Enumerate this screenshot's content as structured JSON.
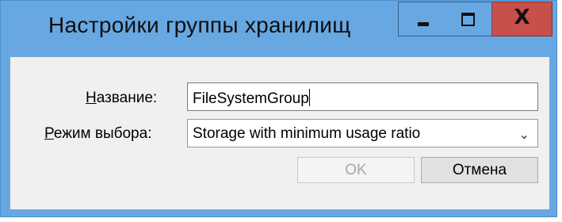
{
  "window": {
    "title": "Настройки группы хранилищ",
    "controls": {
      "minimize": "minimize",
      "maximize": "maximize",
      "close_glyph": "X"
    }
  },
  "form": {
    "name": {
      "label_access": "Н",
      "label_rest": "азвание:",
      "value": "FileSystemGroup"
    },
    "mode": {
      "label_access": "Р",
      "label_rest": "ежим выбора:",
      "selected": "Storage with minimum usage ratio"
    }
  },
  "buttons": {
    "ok": "OK",
    "cancel": "Отмена"
  },
  "colors": {
    "titlebar": "#67a8e2",
    "close_button": "#c7504a",
    "client_bg": "#f0f0f0"
  }
}
